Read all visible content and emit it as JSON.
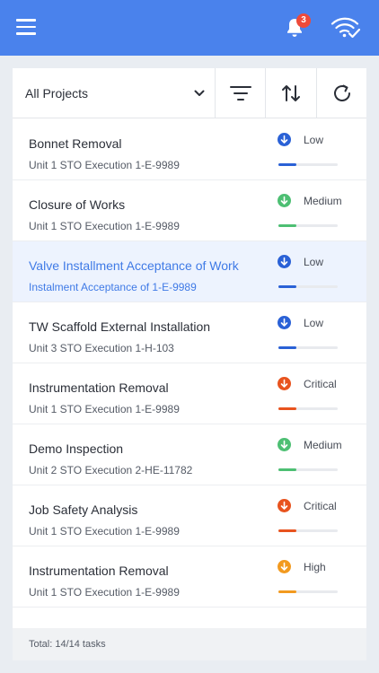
{
  "header": {
    "notification_count": "3"
  },
  "toolbar": {
    "filter_value": "All Projects",
    "icons": [
      "chevron-down-icon",
      "filter-icon",
      "sort-icon",
      "refresh-icon"
    ]
  },
  "priority_colors": {
    "Low": "#2a61d6",
    "Medium": "#4dbf73",
    "Critical": "#e8531e",
    "High": "#f29a1f"
  },
  "tasks": [
    {
      "title": "Bonnet Removal",
      "subtitle": "Unit 1 STO Execution 1-E-9989",
      "priority": "Low",
      "progress": 0.3,
      "selected": false
    },
    {
      "title": "Closure of Works",
      "subtitle": "Unit 1 STO Execution 1-E-9989",
      "priority": "Medium",
      "progress": 0.3,
      "selected": false
    },
    {
      "title": "Valve Installment Acceptance of Work",
      "subtitle": "Instalment Acceptance of 1-E-9989",
      "priority": "Low",
      "progress": 0.3,
      "selected": true
    },
    {
      "title": "TW Scaffold External Installation",
      "subtitle": "Unit 3 STO Execution 1-H-103",
      "priority": "Low",
      "progress": 0.3,
      "selected": false
    },
    {
      "title": "Instrumentation Removal",
      "subtitle": "Unit 1 STO Execution 1-E-9989",
      "priority": "Critical",
      "progress": 0.3,
      "selected": false
    },
    {
      "title": "Demo Inspection",
      "subtitle": "Unit 2 STO Execution 2-HE-11782",
      "priority": "Medium",
      "progress": 0.3,
      "selected": false
    },
    {
      "title": "Job Safety Analysis",
      "subtitle": "Unit 1 STO Execution 1-E-9989",
      "priority": "Critical",
      "progress": 0.3,
      "selected": false
    },
    {
      "title": "Instrumentation Removal",
      "subtitle": "Unit 1 STO Execution 1-E-9989",
      "priority": "High",
      "progress": 0.3,
      "selected": false
    }
  ],
  "footer": {
    "total_text": "Total: 14/14 tasks"
  }
}
